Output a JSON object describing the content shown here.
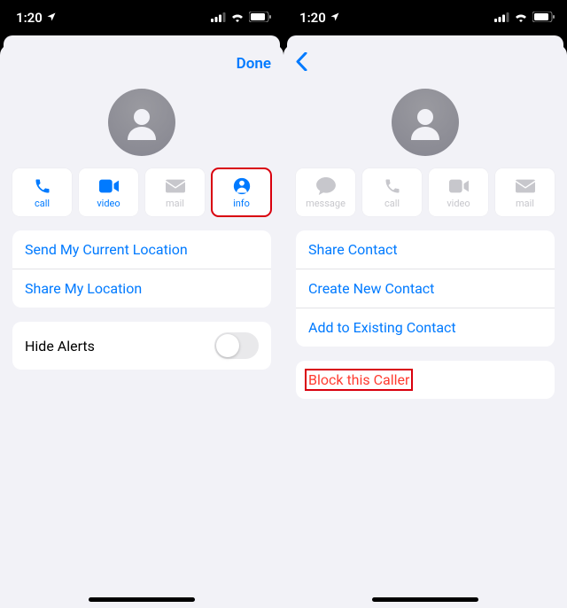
{
  "status": {
    "time": "1:20",
    "location_icon": "location-arrow",
    "signal_icon": "signal-bars",
    "wifi_icon": "wifi",
    "battery_icon": "battery"
  },
  "left": {
    "nav": {
      "done": "Done"
    },
    "actions": {
      "call": "call",
      "video": "video",
      "mail": "mail",
      "info": "info"
    },
    "group1": {
      "send_location": "Send My Current Location",
      "share_location": "Share My Location"
    },
    "group2": {
      "hide_alerts": "Hide Alerts"
    },
    "highlight": "info"
  },
  "right": {
    "nav": {
      "back": "back"
    },
    "actions": {
      "message": "message",
      "call": "call",
      "video": "video",
      "mail": "mail"
    },
    "group1": {
      "share_contact": "Share Contact",
      "create_contact": "Create New Contact",
      "add_existing": "Add to Existing Contact"
    },
    "group2": {
      "block": "Block this Caller"
    },
    "highlight": "block"
  },
  "colors": {
    "accent": "#007aff",
    "danger": "#ff3b30",
    "highlight_box": "#d9000d",
    "inactive": "#c7c7cc",
    "bg": "#f2f2f7"
  }
}
